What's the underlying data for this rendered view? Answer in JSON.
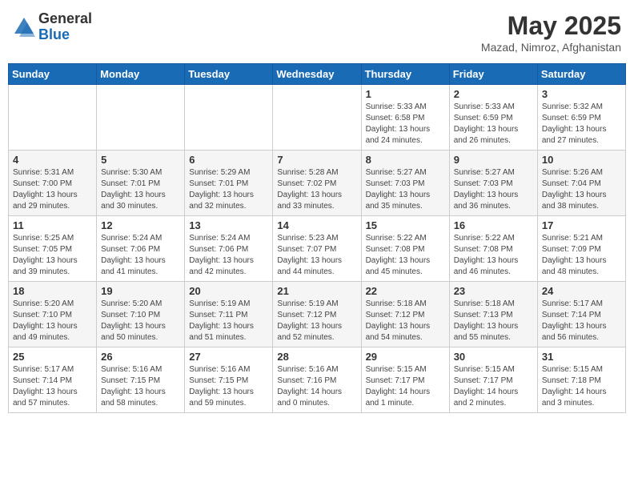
{
  "header": {
    "logo_general": "General",
    "logo_blue": "Blue",
    "title": "May 2025",
    "subtitle": "Mazad, Nimroz, Afghanistan"
  },
  "weekdays": [
    "Sunday",
    "Monday",
    "Tuesday",
    "Wednesday",
    "Thursday",
    "Friday",
    "Saturday"
  ],
  "weeks": [
    [
      {
        "day": "",
        "info": ""
      },
      {
        "day": "",
        "info": ""
      },
      {
        "day": "",
        "info": ""
      },
      {
        "day": "",
        "info": ""
      },
      {
        "day": "1",
        "info": "Sunrise: 5:33 AM\nSunset: 6:58 PM\nDaylight: 13 hours\nand 24 minutes."
      },
      {
        "day": "2",
        "info": "Sunrise: 5:33 AM\nSunset: 6:59 PM\nDaylight: 13 hours\nand 26 minutes."
      },
      {
        "day": "3",
        "info": "Sunrise: 5:32 AM\nSunset: 6:59 PM\nDaylight: 13 hours\nand 27 minutes."
      }
    ],
    [
      {
        "day": "4",
        "info": "Sunrise: 5:31 AM\nSunset: 7:00 PM\nDaylight: 13 hours\nand 29 minutes."
      },
      {
        "day": "5",
        "info": "Sunrise: 5:30 AM\nSunset: 7:01 PM\nDaylight: 13 hours\nand 30 minutes."
      },
      {
        "day": "6",
        "info": "Sunrise: 5:29 AM\nSunset: 7:01 PM\nDaylight: 13 hours\nand 32 minutes."
      },
      {
        "day": "7",
        "info": "Sunrise: 5:28 AM\nSunset: 7:02 PM\nDaylight: 13 hours\nand 33 minutes."
      },
      {
        "day": "8",
        "info": "Sunrise: 5:27 AM\nSunset: 7:03 PM\nDaylight: 13 hours\nand 35 minutes."
      },
      {
        "day": "9",
        "info": "Sunrise: 5:27 AM\nSunset: 7:03 PM\nDaylight: 13 hours\nand 36 minutes."
      },
      {
        "day": "10",
        "info": "Sunrise: 5:26 AM\nSunset: 7:04 PM\nDaylight: 13 hours\nand 38 minutes."
      }
    ],
    [
      {
        "day": "11",
        "info": "Sunrise: 5:25 AM\nSunset: 7:05 PM\nDaylight: 13 hours\nand 39 minutes."
      },
      {
        "day": "12",
        "info": "Sunrise: 5:24 AM\nSunset: 7:06 PM\nDaylight: 13 hours\nand 41 minutes."
      },
      {
        "day": "13",
        "info": "Sunrise: 5:24 AM\nSunset: 7:06 PM\nDaylight: 13 hours\nand 42 minutes."
      },
      {
        "day": "14",
        "info": "Sunrise: 5:23 AM\nSunset: 7:07 PM\nDaylight: 13 hours\nand 44 minutes."
      },
      {
        "day": "15",
        "info": "Sunrise: 5:22 AM\nSunset: 7:08 PM\nDaylight: 13 hours\nand 45 minutes."
      },
      {
        "day": "16",
        "info": "Sunrise: 5:22 AM\nSunset: 7:08 PM\nDaylight: 13 hours\nand 46 minutes."
      },
      {
        "day": "17",
        "info": "Sunrise: 5:21 AM\nSunset: 7:09 PM\nDaylight: 13 hours\nand 48 minutes."
      }
    ],
    [
      {
        "day": "18",
        "info": "Sunrise: 5:20 AM\nSunset: 7:10 PM\nDaylight: 13 hours\nand 49 minutes."
      },
      {
        "day": "19",
        "info": "Sunrise: 5:20 AM\nSunset: 7:10 PM\nDaylight: 13 hours\nand 50 minutes."
      },
      {
        "day": "20",
        "info": "Sunrise: 5:19 AM\nSunset: 7:11 PM\nDaylight: 13 hours\nand 51 minutes."
      },
      {
        "day": "21",
        "info": "Sunrise: 5:19 AM\nSunset: 7:12 PM\nDaylight: 13 hours\nand 52 minutes."
      },
      {
        "day": "22",
        "info": "Sunrise: 5:18 AM\nSunset: 7:12 PM\nDaylight: 13 hours\nand 54 minutes."
      },
      {
        "day": "23",
        "info": "Sunrise: 5:18 AM\nSunset: 7:13 PM\nDaylight: 13 hours\nand 55 minutes."
      },
      {
        "day": "24",
        "info": "Sunrise: 5:17 AM\nSunset: 7:14 PM\nDaylight: 13 hours\nand 56 minutes."
      }
    ],
    [
      {
        "day": "25",
        "info": "Sunrise: 5:17 AM\nSunset: 7:14 PM\nDaylight: 13 hours\nand 57 minutes."
      },
      {
        "day": "26",
        "info": "Sunrise: 5:16 AM\nSunset: 7:15 PM\nDaylight: 13 hours\nand 58 minutes."
      },
      {
        "day": "27",
        "info": "Sunrise: 5:16 AM\nSunset: 7:15 PM\nDaylight: 13 hours\nand 59 minutes."
      },
      {
        "day": "28",
        "info": "Sunrise: 5:16 AM\nSunset: 7:16 PM\nDaylight: 14 hours\nand 0 minutes."
      },
      {
        "day": "29",
        "info": "Sunrise: 5:15 AM\nSunset: 7:17 PM\nDaylight: 14 hours\nand 1 minute."
      },
      {
        "day": "30",
        "info": "Sunrise: 5:15 AM\nSunset: 7:17 PM\nDaylight: 14 hours\nand 2 minutes."
      },
      {
        "day": "31",
        "info": "Sunrise: 5:15 AM\nSunset: 7:18 PM\nDaylight: 14 hours\nand 3 minutes."
      }
    ]
  ]
}
